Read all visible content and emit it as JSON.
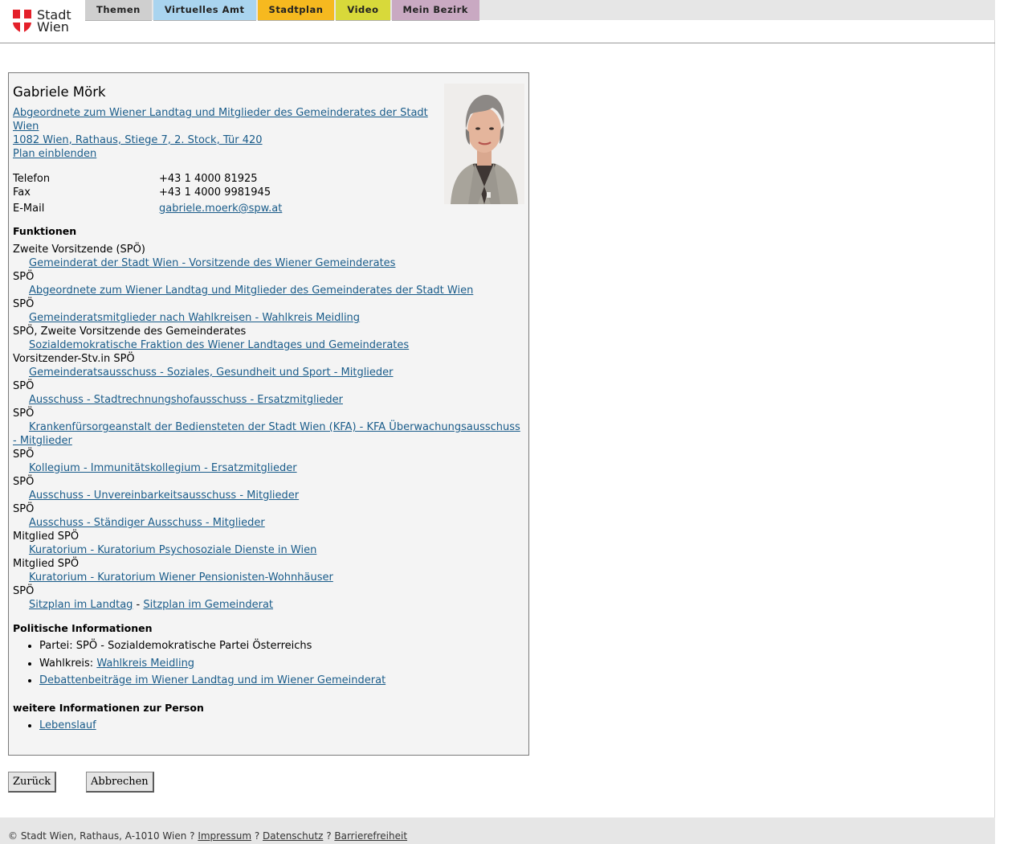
{
  "header": {
    "logo_text_line1": "Stadt",
    "logo_text_line2": "Wien",
    "tabs": [
      {
        "label": "Themen",
        "color": "#cfcfcf"
      },
      {
        "label": "Virtuelles Amt",
        "color": "#a9d4ef"
      },
      {
        "label": "Stadtplan",
        "color": "#f6b91f"
      },
      {
        "label": "Video",
        "color": "#d8d93a"
      },
      {
        "label": "Mein Bezirk",
        "color": "#c9a9c2"
      }
    ]
  },
  "person": {
    "name": "Gabriele Mörk",
    "role_link": "Abgeordnete zum Wiener Landtag und Mitglieder des Gemeinderates der Stadt Wien ",
    "address_link": "1082 Wien, Rathaus, Stiege 7, 2. Stock, Tür 420",
    "map_link": "Plan einblenden",
    "contact": [
      {
        "label": "Telefon",
        "value": "+43 1 4000 81925"
      },
      {
        "label": "Fax",
        "value": "+43 1 4000 9981945"
      },
      {
        "label": "E-Mail",
        "value": "gabriele.moerk@spw.at"
      }
    ]
  },
  "functions": {
    "title": "Funktionen",
    "items": [
      {
        "role": "Zweite Vorsitzende (SPÖ)",
        "link": "Gemeinderat der Stadt Wien - Vorsitzende des Wiener Gemeinderates"
      },
      {
        "role": "SPÖ",
        "link": "Abgeordnete zum Wiener Landtag und Mitglieder des Gemeinderates der Stadt Wien"
      },
      {
        "role": "SPÖ",
        "link": "Gemeinderatsmitglieder nach Wahlkreisen - Wahlkreis Meidling"
      },
      {
        "role": "SPÖ, Zweite Vorsitzende des Gemeinderates",
        "link": "Sozialdemokratische Fraktion des Wiener Landtages und Gemeinderates"
      },
      {
        "role": "Vorsitzender-Stv.in SPÖ",
        "link": "Gemeinderatsausschuss - Soziales, Gesundheit und Sport - Mitglieder"
      },
      {
        "role": "SPÖ",
        "link": "Ausschuss - Stadtrechnungshofausschuss - Ersatzmitglieder"
      },
      {
        "role": "SPÖ",
        "link": "Krankenfürsorgeanstalt der Bediensteten der Stadt Wien (KFA) - KFA Überwachungsausschuss - Mitglieder"
      },
      {
        "role": "SPÖ",
        "link": "Kollegium - Immunitätskollegium - Ersatzmitglieder"
      },
      {
        "role": "SPÖ",
        "link": "Ausschuss - Unvereinbarkeitsausschuss - Mitglieder"
      },
      {
        "role": "SPÖ",
        "link": "Ausschuss - Ständiger Ausschuss - Mitglieder"
      },
      {
        "role": "Mitglied SPÖ",
        "link": "Kuratorium - Kuratorium Psychosoziale Dienste in Wien"
      },
      {
        "role": "Mitglied SPÖ",
        "link": "Kuratorium - Kuratorium Wiener Pensionisten-Wohnhäuser"
      }
    ],
    "last_role": "SPÖ",
    "seat_link_1": "Sitzplan im Landtag",
    "seat_separator": " - ",
    "seat_link_2": "Sitzplan im Gemeinderat"
  },
  "political": {
    "title": "Politische Informationen",
    "party": "Partei: SPÖ - Sozialdemokratische Partei Österreichs",
    "district_label": "Wahlkreis: ",
    "district_link": "Wahlkreis Meidling",
    "debates_link": "Debattenbeiträge im Wiener Landtag und im Wiener Gemeinderat"
  },
  "more": {
    "title": "weitere Informationen zur Person",
    "cv_link": "Lebenslauf"
  },
  "buttons": {
    "back": "Zurück",
    "cancel": "Abbrechen"
  },
  "footer": {
    "copyright": "© Stadt Wien, Rathaus, A-1010 Wien ? ",
    "imprint": "Impressum",
    "sep1": " ? ",
    "privacy": "Datenschutz",
    "sep2": " ? ",
    "accessibility": "Barrierefreiheit"
  }
}
